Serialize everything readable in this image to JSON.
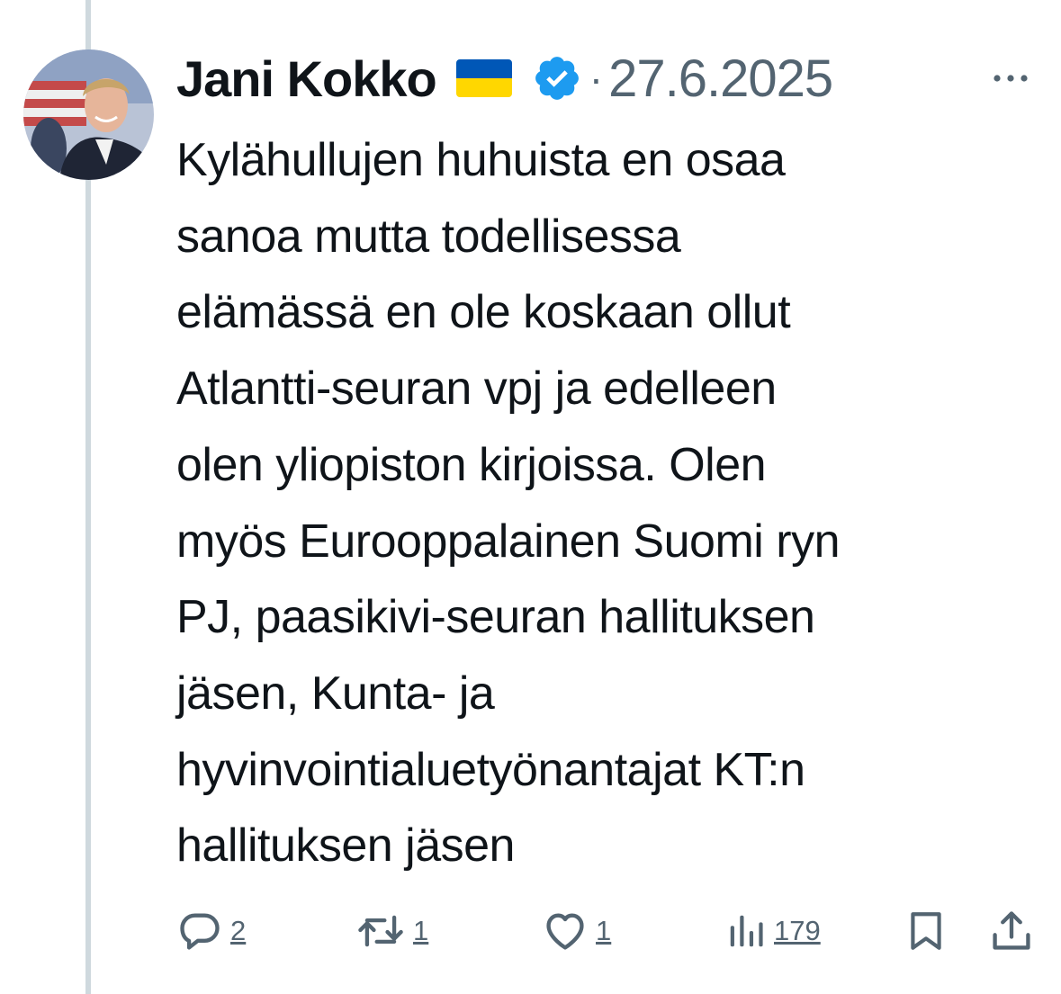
{
  "post": {
    "author": {
      "name": "Jani Kokko",
      "flag_icon": "ukraine-flag-icon",
      "verified_icon": "verified-badge-icon"
    },
    "separator": "·",
    "date": "27.6.2025",
    "text": "Kylähullujen huhuista en osaa\nsanoa mutta todellisessa\nelämässä en ole koskaan ollut\nAtlantti-seuran vpj ja edelleen\nolen yliopiston kirjoissa. Olen\nmyös Eurooppalainen Suomi ryn\nPJ, paasikivi-seuran hallituksen\njäsen, Kunta- ja\nhyvinvointialuetyönantajat KT:n\nhallituksen jäsen"
  },
  "actions": {
    "replies": {
      "icon": "reply-icon",
      "count": "2"
    },
    "reposts": {
      "icon": "repost-icon",
      "count": "1"
    },
    "likes": {
      "icon": "heart-icon",
      "count": "1"
    },
    "views": {
      "icon": "views-icon",
      "count": "179"
    },
    "bookmark": {
      "icon": "bookmark-icon"
    },
    "share": {
      "icon": "share-icon"
    }
  },
  "colors": {
    "text_primary": "#0f1419",
    "text_secondary": "#536471",
    "verified_blue": "#1d9bf0",
    "thread_line": "#cfd9de",
    "flag_blue": "#0057b7",
    "flag_yellow": "#ffd700"
  }
}
